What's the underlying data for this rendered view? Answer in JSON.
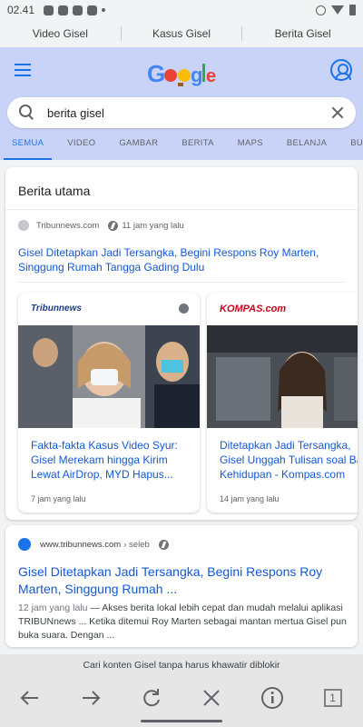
{
  "statusbar": {
    "time": "02.41"
  },
  "suggestions": [
    "Video Gisel",
    "Kasus Gisel",
    "Berita Gisel"
  ],
  "search": {
    "query": "berita gisel"
  },
  "tabs": [
    "SEMUA",
    "VIDEO",
    "GAMBAR",
    "BERITA",
    "MAPS",
    "BELANJA",
    "BUKU"
  ],
  "top_stories": {
    "title": "Berita utama",
    "top": {
      "source": "Tribunnews.com",
      "time": "11 jam yang lalu",
      "headline": "Gisel Ditetapkan Jadi Tersangka, Begini Respons Roy Marten, Singgung Rumah Tangga Gading Dulu"
    },
    "cards": [
      {
        "publisher": "Tribunnews",
        "title": "Fakta-fakta Kasus Video Syur: Gisel Merekam hingga Kirim Lewat AirDrop, MYD Hapus... setelah Seminggu",
        "time": "7 jam yang lalu"
      },
      {
        "publisher": "KOMPAS.com",
        "title": "Ditetapkan Jadi Tersangka, Gisel Unggah Tulisan soal Badai Kehidupan - Kompas.com",
        "time": "14 jam yang lalu"
      }
    ]
  },
  "result": {
    "url": "www.tribunnews.com",
    "crumb": "› seleb",
    "title": "Gisel Ditetapkan Jadi Tersangka, Begini Respons Roy Marten, Singgung Rumah ...",
    "date": "12 jam yang lalu",
    "snippet": " — Akses berita lokal lebih cepat dan mudah melalui aplikasi TRIBUNnews ... Ketika ditemui Roy Marten sebagai mantan mertua Gisel pun buka suara. Dengan ..."
  },
  "bottom": {
    "banner": "Cari konten Gisel tanpa harus khawatir diblokir",
    "tab_count": "1"
  }
}
